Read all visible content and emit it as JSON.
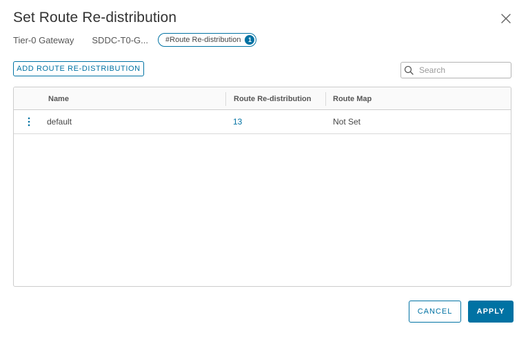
{
  "dialog": {
    "title": "Set Route Re-distribution",
    "close_icon": "close-icon"
  },
  "breadcrumb": {
    "gateway_label": "Tier-0 Gateway",
    "gateway_name": "SDDC-T0-G...",
    "pill_label": "#Route Re-distribution",
    "pill_count": "1"
  },
  "toolbar": {
    "add_label": "ADD ROUTE RE-DISTRIBUTION",
    "search_placeholder": "Search",
    "search_value": "",
    "search_icon": "search-icon"
  },
  "grid": {
    "columns": [
      "Name",
      "Route Re-distribution",
      "Route Map"
    ],
    "rows": [
      {
        "name": "default",
        "route_redistribution": "13",
        "route_map": "Not Set"
      }
    ]
  },
  "footer": {
    "cancel_label": "CANCEL",
    "apply_label": "APPLY"
  },
  "colors": {
    "accent": "#0072a3",
    "border": "#cccccc",
    "header_bg": "#fafafa"
  }
}
